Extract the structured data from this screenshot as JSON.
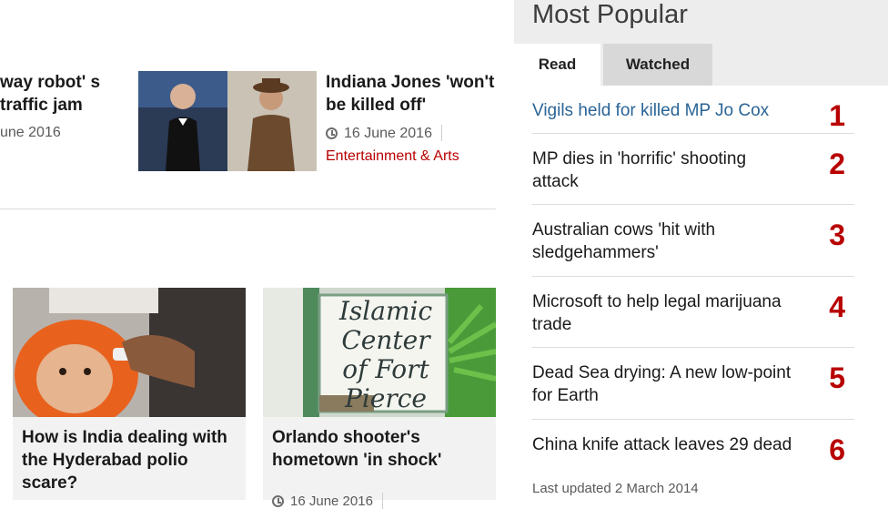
{
  "top_stories": [
    {
      "title": "way robot' s traffic jam",
      "date": "une 2016"
    },
    {
      "title": "Indiana Jones 'won't be killed off'",
      "date": "16 June 2016",
      "topic": "Entertainment & Arts"
    }
  ],
  "bottom_stories": [
    {
      "title": "How is India dealing with the Hyderabad polio scare?"
    },
    {
      "title": "Orlando shooter's hometown 'in shock'",
      "date": "16 June 2016",
      "image_sign_text": "Islamic Center of Fort Pierce"
    }
  ],
  "most_popular": {
    "heading": "Most Popular",
    "tabs": [
      {
        "label": "Read",
        "active": true
      },
      {
        "label": "Watched",
        "active": false
      }
    ],
    "items": [
      {
        "rank": "1",
        "title": "Vigils held for killed MP Jo Cox"
      },
      {
        "rank": "2",
        "title": "MP dies in 'horrific' shooting attack"
      },
      {
        "rank": "3",
        "title": "Australian cows 'hit with sledgehammers'"
      },
      {
        "rank": "4",
        "title": "Microsoft to help legal marijuana trade"
      },
      {
        "rank": "5",
        "title": "Dead Sea drying: A new low-point for Earth"
      },
      {
        "rank": "6",
        "title": "China knife attack leaves 29 dead",
        "updated": "Last updated 2 March 2014"
      }
    ]
  },
  "colors": {
    "accent_red": "#b80000",
    "link_blue": "#2a6496"
  }
}
